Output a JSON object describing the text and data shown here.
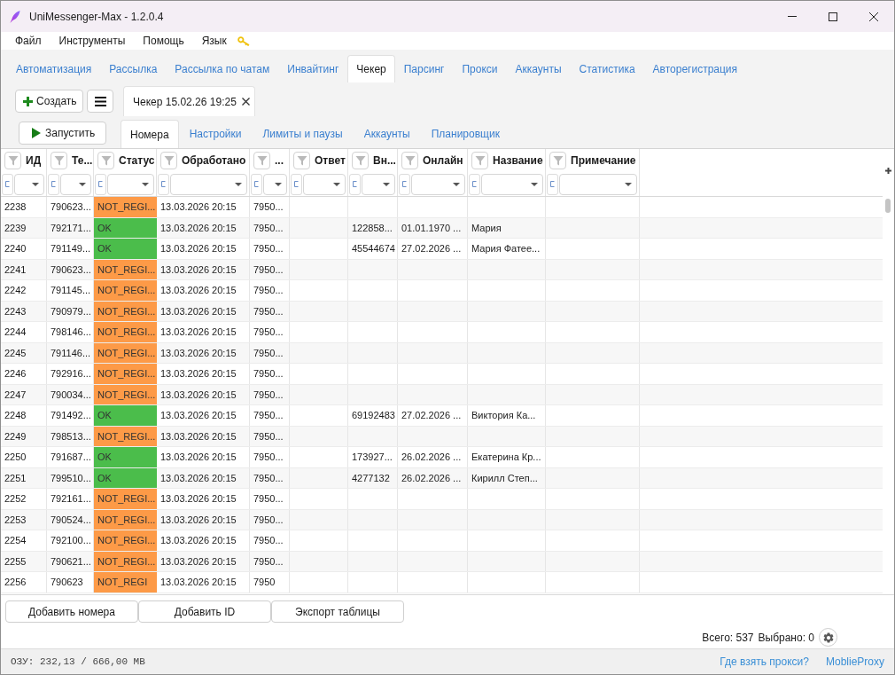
{
  "window": {
    "title": "UniMessenger-Max - 1.2.0.4"
  },
  "menu": [
    "Файл",
    "Инструменты",
    "Помощь",
    "Язык"
  ],
  "main_tabs": [
    {
      "label": "Автоматизация",
      "selected": false
    },
    {
      "label": "Рассылка",
      "selected": false
    },
    {
      "label": "Рассылка по чатам",
      "selected": false
    },
    {
      "label": "Инвайтинг",
      "selected": false
    },
    {
      "label": "Чекер",
      "selected": true
    },
    {
      "label": "Парсинг",
      "selected": false
    },
    {
      "label": "Прокси",
      "selected": false
    },
    {
      "label": "Аккаунты",
      "selected": false
    },
    {
      "label": "Статистика",
      "selected": false
    },
    {
      "label": "Авторегистрация",
      "selected": false
    }
  ],
  "toolbar": {
    "create_button": "Создать"
  },
  "document_tabs": [
    {
      "label": "Чекер 15.02.26 19:25",
      "selected": true
    }
  ],
  "run_button": "Запустить",
  "sub_tabs": [
    {
      "label": "Номера",
      "selected": true
    },
    {
      "label": "Настройки",
      "selected": false
    },
    {
      "label": "Лимиты и паузы",
      "selected": false
    },
    {
      "label": "Аккаунты",
      "selected": false
    },
    {
      "label": "Планировщик",
      "selected": false
    }
  ],
  "table": {
    "columns": [
      "ИД",
      "Те...",
      "Статус",
      "Обработано",
      "...",
      "Ответ",
      "Вн...",
      "Онлайн",
      "Название",
      "Примечание"
    ],
    "rows": [
      {
        "id": "2238",
        "column_2": "790623...",
        "status": "NOT_REGI...",
        "color": "#fd9a47",
        "processed": "13.03.2026 20:15",
        "column_5": "7950..."
      },
      {
        "id": "2239",
        "column_2": "792171...",
        "status": "OK",
        "color": "#4bbd4b",
        "processed": "13.03.2026 20:15",
        "column_5": "7950...",
        "column_7": "122858...",
        "online": "01.01.1970 ...",
        "name": "Мария"
      },
      {
        "id": "2240",
        "column_2": "791149...",
        "status": "OK",
        "color": "#4bbd4b",
        "processed": "13.03.2026 20:15",
        "column_5": "7950...",
        "column_7": "45544674",
        "online": "27.02.2026 ...",
        "name": "Мария Фатее..."
      },
      {
        "id": "2241",
        "column_2": "790623...",
        "status": "NOT_REGI...",
        "color": "#fd9a47",
        "processed": "13.03.2026 20:15",
        "column_5": "7950..."
      },
      {
        "id": "2242",
        "column_2": "791145...",
        "status": "NOT_REGI...",
        "color": "#fd9a47",
        "processed": "13.03.2026 20:15",
        "column_5": "7950..."
      },
      {
        "id": "2243",
        "column_2": "790979...",
        "status": "NOT_REGI...",
        "color": "#fd9a47",
        "processed": "13.03.2026 20:15",
        "column_5": "7950..."
      },
      {
        "id": "2244",
        "column_2": "798146...",
        "status": "NOT_REGI...",
        "color": "#fd9a47",
        "processed": "13.03.2026 20:15",
        "column_5": "7950..."
      },
      {
        "id": "2245",
        "column_2": "791146...",
        "status": "NOT_REGI...",
        "color": "#fd9a47",
        "processed": "13.03.2026 20:15",
        "column_5": "7950..."
      },
      {
        "id": "2246",
        "column_2": "792916...",
        "status": "NOT_REGI...",
        "color": "#fd9a47",
        "processed": "13.03.2026 20:15",
        "column_5": "7950..."
      },
      {
        "id": "2247",
        "column_2": "790034...",
        "status": "NOT_REGI...",
        "color": "#fd9a47",
        "processed": "13.03.2026 20:15",
        "column_5": "7950..."
      },
      {
        "id": "2248",
        "column_2": "791492...",
        "status": "OK",
        "color": "#4bbd4b",
        "processed": "13.03.2026 20:15",
        "column_5": "7950...",
        "column_7": "69192483",
        "online": "27.02.2026 ...",
        "name": "Виктория Ка..."
      },
      {
        "id": "2249",
        "column_2": "798513...",
        "status": "NOT_REGI...",
        "color": "#fd9a47",
        "processed": "13.03.2026 20:15",
        "column_5": "7950..."
      },
      {
        "id": "2250",
        "column_2": "791687...",
        "status": "OK",
        "color": "#4bbd4b",
        "processed": "13.03.2026 20:15",
        "column_5": "7950...",
        "column_7": "173927...",
        "online": "26.02.2026 ...",
        "name": "Екатерина Кр..."
      },
      {
        "id": "2251",
        "column_2": "799510...",
        "status": "OK",
        "color": "#4bbd4b",
        "processed": "13.03.2026 20:15",
        "column_5": "7950...",
        "column_7": "4277132",
        "online": "26.02.2026 ...",
        "name": "Кирилл Степ..."
      },
      {
        "id": "2252",
        "column_2": "792161...",
        "status": "NOT_REGI...",
        "color": "#fd9a47",
        "processed": "13.03.2026 20:15",
        "column_5": "7950..."
      },
      {
        "id": "2253",
        "column_2": "790524...",
        "status": "NOT_REGI...",
        "color": "#fd9a47",
        "processed": "13.03.2026 20:15",
        "column_5": "7950..."
      },
      {
        "id": "2254",
        "column_2": "792100...",
        "status": "NOT_REGI...",
        "color": "#fd9a47",
        "processed": "13.03.2026 20:15",
        "column_5": "7950..."
      },
      {
        "id": "2255",
        "column_2": "790621...",
        "status": "NOT_REGI...",
        "color": "#fd9a47",
        "processed": "13.03.2026 20:15",
        "column_5": "7950..."
      },
      {
        "id": "2256",
        "column_2": "790623",
        "status": "NOT_REGI",
        "color": "#fd9a47",
        "processed": "13.03.2026 20:15",
        "column_5": "7950"
      }
    ]
  },
  "buttons": [
    "Добавить номера",
    "Добавить ID",
    "Экспорт таблицы"
  ],
  "summary": {
    "total": "Всего: 537",
    "selected": "Выбрано: 0"
  },
  "status_bar": {
    "memory": "ОЗУ: 232,13 / 666,00 MB",
    "links": [
      "Где взять прокси?",
      "MoblieProxy"
    ]
  }
}
